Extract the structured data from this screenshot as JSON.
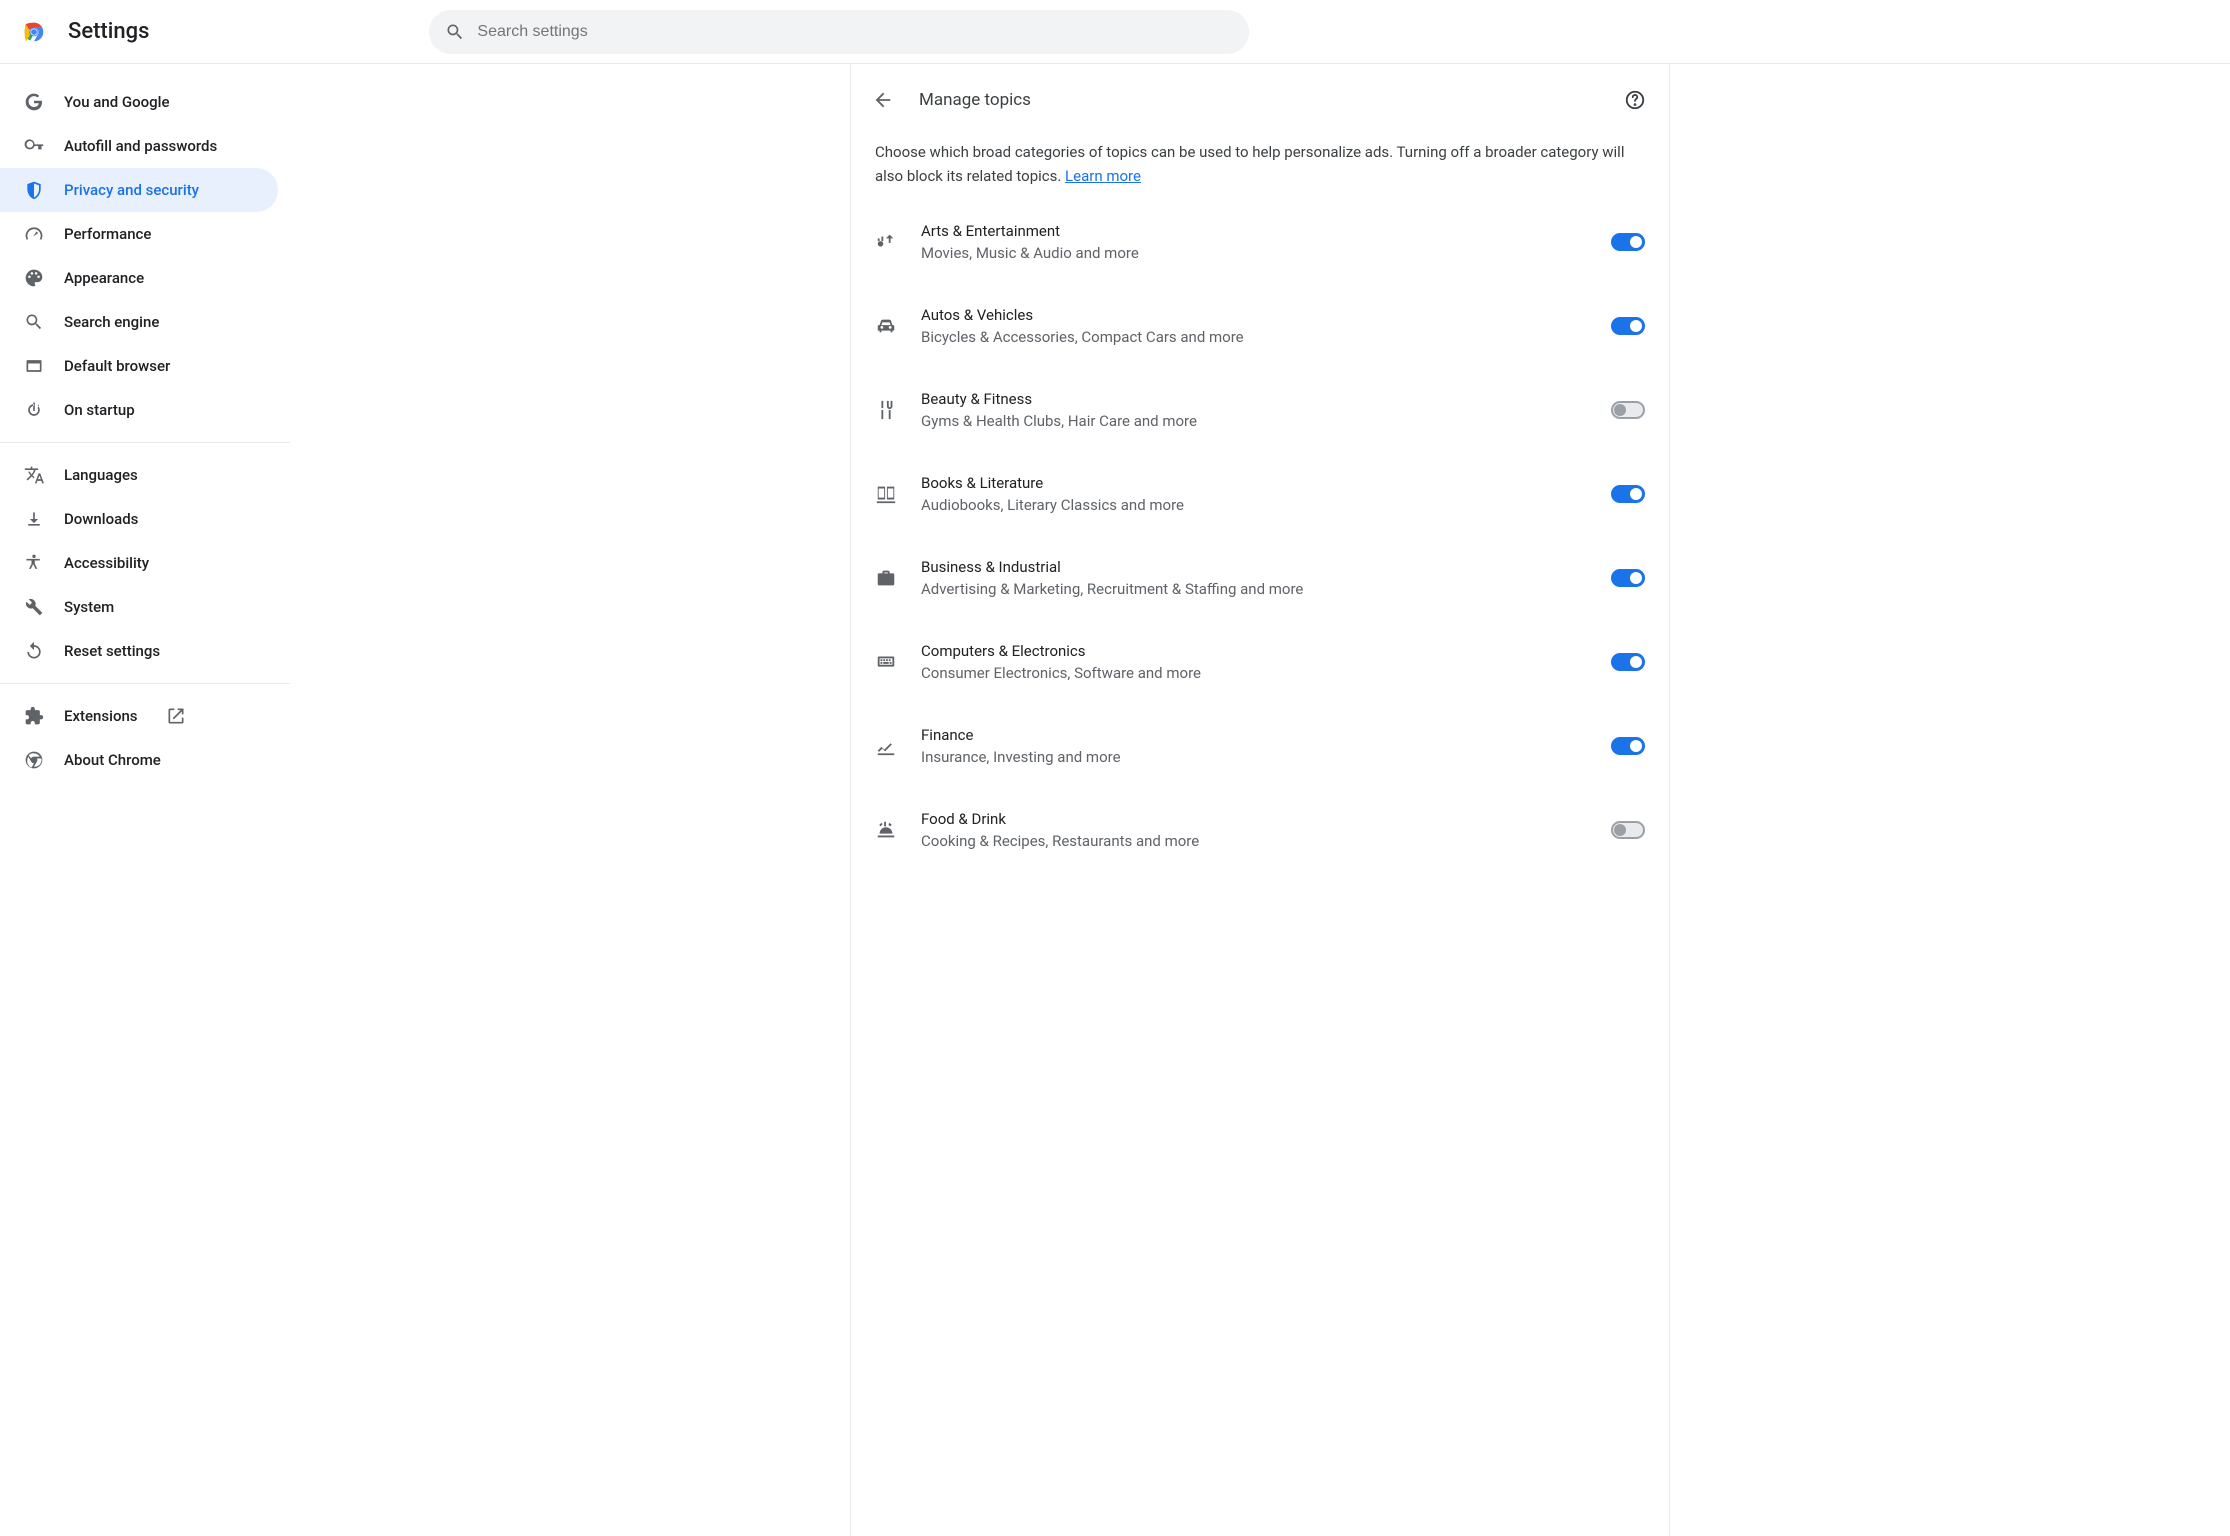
{
  "app_title": "Settings",
  "search": {
    "placeholder": "Search settings"
  },
  "sidebar": {
    "items": [
      {
        "key": "you-and-google",
        "label": "You and Google",
        "active": false
      },
      {
        "key": "autofill",
        "label": "Autofill and passwords",
        "active": false
      },
      {
        "key": "privacy",
        "label": "Privacy and security",
        "active": true
      },
      {
        "key": "performance",
        "label": "Performance",
        "active": false
      },
      {
        "key": "appearance",
        "label": "Appearance",
        "active": false
      },
      {
        "key": "search-engine",
        "label": "Search engine",
        "active": false
      },
      {
        "key": "default-browser",
        "label": "Default browser",
        "active": false
      },
      {
        "key": "on-startup",
        "label": "On startup",
        "active": false
      }
    ],
    "more": [
      {
        "key": "languages",
        "label": "Languages"
      },
      {
        "key": "downloads",
        "label": "Downloads"
      },
      {
        "key": "accessibility",
        "label": "Accessibility"
      },
      {
        "key": "system",
        "label": "System"
      },
      {
        "key": "reset",
        "label": "Reset settings"
      }
    ],
    "footer": [
      {
        "key": "extensions",
        "label": "Extensions",
        "external": true
      },
      {
        "key": "about",
        "label": "About Chrome"
      }
    ]
  },
  "page": {
    "title": "Manage topics",
    "description_prefix": "Choose which broad categories of topics can be used to help personalize ads. Turning off a broader category will also block its related topics. ",
    "learn_more": "Learn more",
    "topics": [
      {
        "key": "arts",
        "title": "Arts & Entertainment",
        "sub": "Movies, Music & Audio and more",
        "on": true
      },
      {
        "key": "autos",
        "title": "Autos & Vehicles",
        "sub": "Bicycles & Accessories, Compact Cars and more",
        "on": true
      },
      {
        "key": "beauty",
        "title": "Beauty & Fitness",
        "sub": "Gyms & Health Clubs, Hair Care and more",
        "on": false
      },
      {
        "key": "books",
        "title": "Books & Literature",
        "sub": "Audiobooks, Literary Classics and more",
        "on": true
      },
      {
        "key": "business",
        "title": "Business & Industrial",
        "sub": "Advertising & Marketing, Recruitment & Staffing and more",
        "on": true
      },
      {
        "key": "computers",
        "title": "Computers & Electronics",
        "sub": "Consumer Electronics, Software and more",
        "on": true
      },
      {
        "key": "finance",
        "title": "Finance",
        "sub": "Insurance, Investing and more",
        "on": true
      },
      {
        "key": "food",
        "title": "Food & Drink",
        "sub": "Cooking & Recipes, Restaurants and more",
        "on": false
      }
    ]
  }
}
